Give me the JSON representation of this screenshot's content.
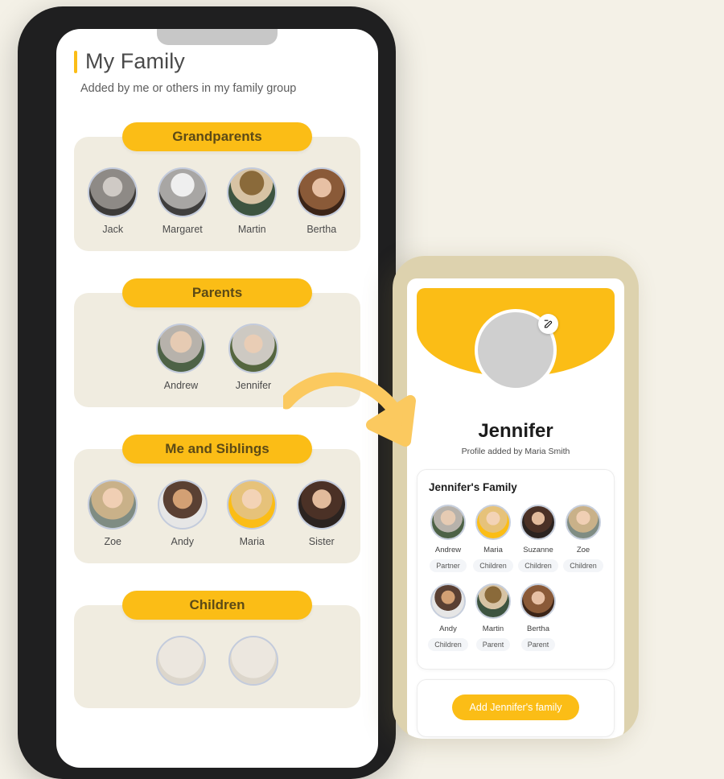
{
  "theme": {
    "background": "#f4f1e7",
    "accent_yellow": "#fbbd16",
    "card_beige": "#f0ece0",
    "phone1_bezel": "#1f1f20",
    "phone2_bezel": "#ddd2ae",
    "avatar_ring": "#c3cbdc"
  },
  "phone1": {
    "title": "My Family",
    "subtitle": "Added by me or others in my family group",
    "groups": [
      {
        "label": "Grandparents",
        "members": [
          {
            "name": "Jack",
            "tone": "gray-dark",
            "style": "bw-elder-man"
          },
          {
            "name": "Margaret",
            "tone": "gray-light",
            "style": "bw-elder-woman"
          },
          {
            "name": "Martin",
            "tone": "green",
            "style": "hat-man"
          },
          {
            "name": "Bertha",
            "tone": "brown",
            "style": "brown-woman"
          }
        ]
      },
      {
        "label": "Parents",
        "members": [
          {
            "name": "Andrew",
            "tone": "green",
            "style": "bearded-man"
          },
          {
            "name": "Jennifer",
            "tone": "green",
            "style": "gray-hair-woman"
          }
        ]
      },
      {
        "label": "Me and Siblings",
        "members": [
          {
            "name": "Zoe",
            "tone": "gray-green",
            "style": "blonde-woman"
          },
          {
            "name": "Andy",
            "tone": "gray-light",
            "style": "young-man"
          },
          {
            "name": "Maria",
            "tone": "yellow",
            "style": "blonde-yellow-woman"
          },
          {
            "name": "Sister",
            "tone": "dark",
            "style": "dark-woman"
          }
        ]
      },
      {
        "label": "Children",
        "members": [
          {
            "name": "",
            "tone": "gray-light",
            "style": "partial"
          },
          {
            "name": "",
            "tone": "gray-light",
            "style": "partial"
          }
        ]
      }
    ]
  },
  "phone2": {
    "profile": {
      "name": "Jennifer",
      "added_by": "Profile added by Maria Smith",
      "edit_icon": "pencil-edit-icon"
    },
    "family_section": {
      "title": "Jennifer's Family",
      "members": [
        {
          "name": "Andrew",
          "relation": "Partner",
          "tone": "green",
          "style": "bearded-man"
        },
        {
          "name": "Maria",
          "relation": "Children",
          "tone": "yellow",
          "style": "blonde-yellow-woman"
        },
        {
          "name": "Suzanne",
          "relation": "Children",
          "tone": "dark",
          "style": "dark-woman"
        },
        {
          "name": "Zoe",
          "relation": "Children",
          "tone": "gray-green",
          "style": "blonde-woman"
        },
        {
          "name": "Andy",
          "relation": "Children",
          "tone": "gray-light",
          "style": "young-man"
        },
        {
          "name": "Martin",
          "relation": "Parent",
          "tone": "green",
          "style": "hat-man"
        },
        {
          "name": "Bertha",
          "relation": "Parent",
          "tone": "brown",
          "style": "brown-woman"
        }
      ]
    },
    "add_button_label": "Add Jennifer's family"
  },
  "arrow": {
    "name": "curved-arrow",
    "color": "#fbc95f",
    "direction": "left-to-right-down"
  }
}
